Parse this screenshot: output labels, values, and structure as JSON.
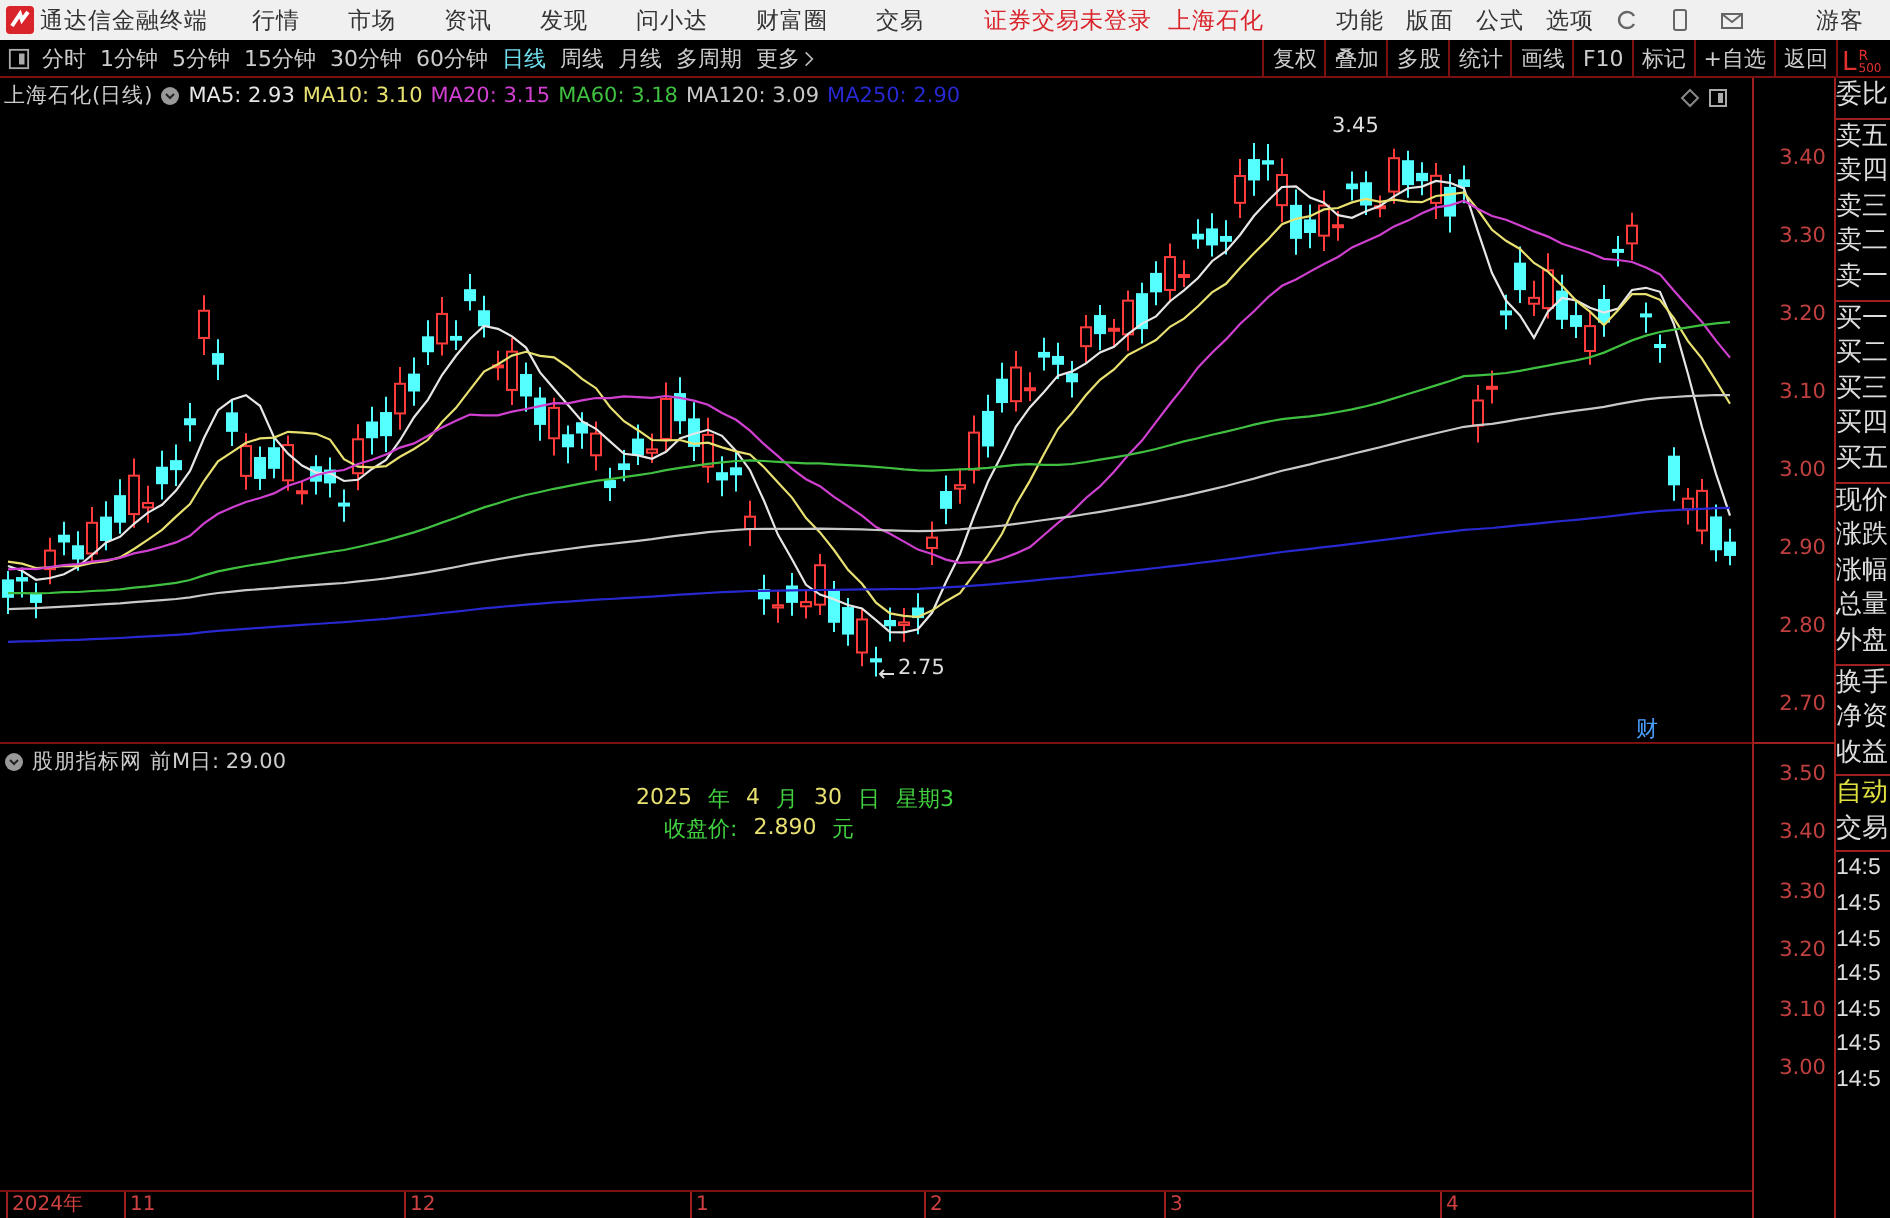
{
  "app": {
    "name": "通达信金融终端",
    "menu": [
      "行情",
      "市场",
      "资讯",
      "发现",
      "问小达",
      "财富圈",
      "交易"
    ],
    "status": [
      "证券交易未登录",
      "上海石化"
    ],
    "right_menu": [
      "功能",
      "版面",
      "公式",
      "选项"
    ],
    "user": "游客"
  },
  "period_bar": {
    "periods": [
      {
        "label": "分时",
        "selected": false
      },
      {
        "label": "1分钟",
        "selected": false
      },
      {
        "label": "5分钟",
        "selected": false
      },
      {
        "label": "15分钟",
        "selected": false
      },
      {
        "label": "30分钟",
        "selected": false
      },
      {
        "label": "60分钟",
        "selected": false
      },
      {
        "label": "日线",
        "selected": true
      },
      {
        "label": "周线",
        "selected": false
      },
      {
        "label": "月线",
        "selected": false
      },
      {
        "label": "多周期",
        "selected": false
      }
    ],
    "more": "更多",
    "tools": [
      "复权",
      "叠加",
      "多股",
      "统计",
      "画线",
      "F10",
      "标记",
      "+自选",
      "返回"
    ],
    "corner": {
      "left": "L",
      "right": "R",
      "sub": "500"
    }
  },
  "main_chart": {
    "title": "上海石化(日线)",
    "ma": [
      {
        "label": "MA5: 2.93",
        "color": "#e6e6e6"
      },
      {
        "label": "MA10: 3.10",
        "color": "#e8e070"
      },
      {
        "label": "MA20: 3.15",
        "color": "#d040d0"
      },
      {
        "label": "MA60: 3.18",
        "color": "#40c040"
      },
      {
        "label": "MA120: 3.09",
        "color": "#c8c8c8"
      },
      {
        "label": "MA250: 2.90",
        "color": "#2828d0"
      }
    ],
    "yticks": [
      "3.40",
      "3.30",
      "3.20",
      "3.10",
      "3.00",
      "2.90",
      "2.80",
      "2.70"
    ],
    "high_label": "3.45",
    "low_label": "2.75",
    "marker": "财"
  },
  "indicator": {
    "title": "股朋指标网",
    "param": "前M日: 29.00",
    "date_line": [
      {
        "text": "2025",
        "kind": "value"
      },
      {
        "text": "年",
        "kind": "unit"
      },
      {
        "text": "4",
        "kind": "value"
      },
      {
        "text": "月",
        "kind": "unit"
      },
      {
        "text": "30",
        "kind": "value"
      },
      {
        "text": "日",
        "kind": "unit"
      },
      {
        "text": "星期3",
        "kind": "unit"
      }
    ],
    "close_line": [
      {
        "text": "收盘价:",
        "kind": "unit"
      },
      {
        "text": "2.890",
        "kind": "value"
      },
      {
        "text": "元",
        "kind": "unit"
      }
    ],
    "yticks": [
      "3.50",
      "3.40",
      "3.30",
      "3.20",
      "3.10",
      "3.00"
    ]
  },
  "quote_panel": {
    "groups": [
      [
        "委比"
      ],
      [
        "卖五",
        "卖四",
        "卖三",
        "卖二",
        "卖一"
      ],
      [
        "买一",
        "买二",
        "买三",
        "买四",
        "买五"
      ],
      [
        "现价",
        "涨跌",
        "涨幅",
        "总量",
        "外盘"
      ],
      [
        "换手",
        "净资",
        "收益"
      ],
      [
        "自动",
        "交易"
      ],
      [
        "14:5",
        "14:5",
        "14:5",
        "14:5",
        "14:5",
        "14:5",
        "14:5"
      ]
    ]
  },
  "x_axis": [
    "2024年",
    "11",
    "12",
    "1",
    "2",
    "3",
    "4"
  ]
}
